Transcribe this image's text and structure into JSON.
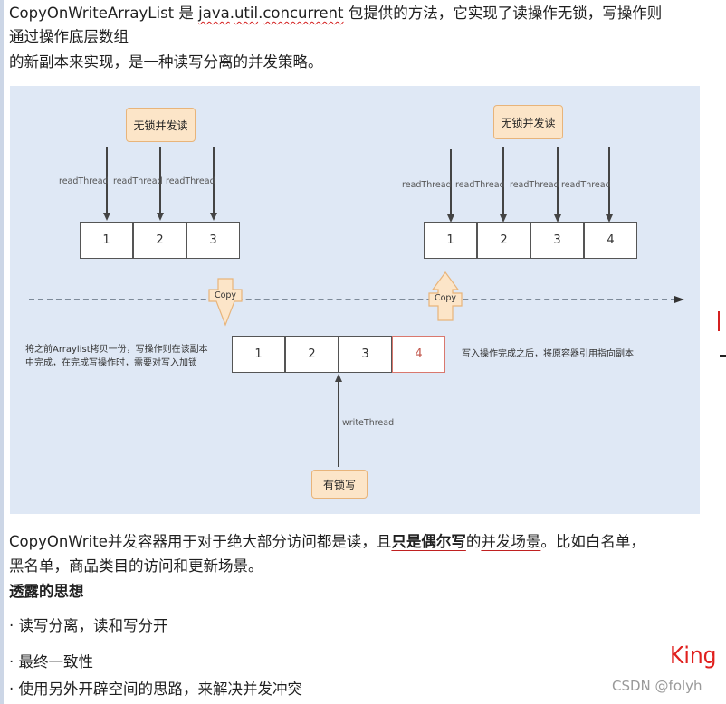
{
  "intro": {
    "line1_parts": [
      "CopyOnWriteArrayList 是 ",
      "java",
      ".",
      "util",
      ".",
      "concurrent",
      " 包提供的方法，它实现了读操作无锁，写操作则"
    ],
    "line2": "通过操作底层数组",
    "line3": "的新副本来实现，是一种读写分离的并发策略。"
  },
  "diagram": {
    "left_read_label": "无锁并发读",
    "right_read_label": "无锁并发读",
    "write_label": "有锁写",
    "copy_down_label": "Copy",
    "copy_up_label": "Copy",
    "thread_read": "readThread",
    "thread_write": "writeThread",
    "left_array": [
      "1",
      "2",
      "3"
    ],
    "right_array": [
      "1",
      "2",
      "3",
      "4"
    ],
    "copy_array": [
      "1",
      "2",
      "3",
      "4"
    ],
    "note_left_line1": "将之前Arraylist拷贝一份，写操作则在该副本",
    "note_left_line2": "中完成，在完成写操作时，需要对写入加锁",
    "note_right": "写入操作完成之后，将原容器引用指向副本"
  },
  "body": {
    "p1_a": "CopyOnWrite并发容器用于对于绝大部分访问都是读，且",
    "p1_bold": "只是偶尔写",
    "p1_b": "的",
    "p1_ul": "并发场景",
    "p1_c": "。比如白名单，",
    "p2": "黑名单，商品类目的访问和更新场景。",
    "heading": "透露的思想",
    "bullets": [
      "· 读写分离，读和写分开",
      "· 最终一致性",
      "· 使用另外开辟空间的思路，来解决并发冲突"
    ]
  },
  "watermark": {
    "king": "King",
    "csdn": "CSDN @folyh"
  },
  "colors": {
    "diagram_bg": "#dfe8f5",
    "label_fill": "#fce5c8",
    "label_border": "#e8b47a",
    "highlight_cell": "#d9786e",
    "annotation_red": "#e0201e"
  }
}
